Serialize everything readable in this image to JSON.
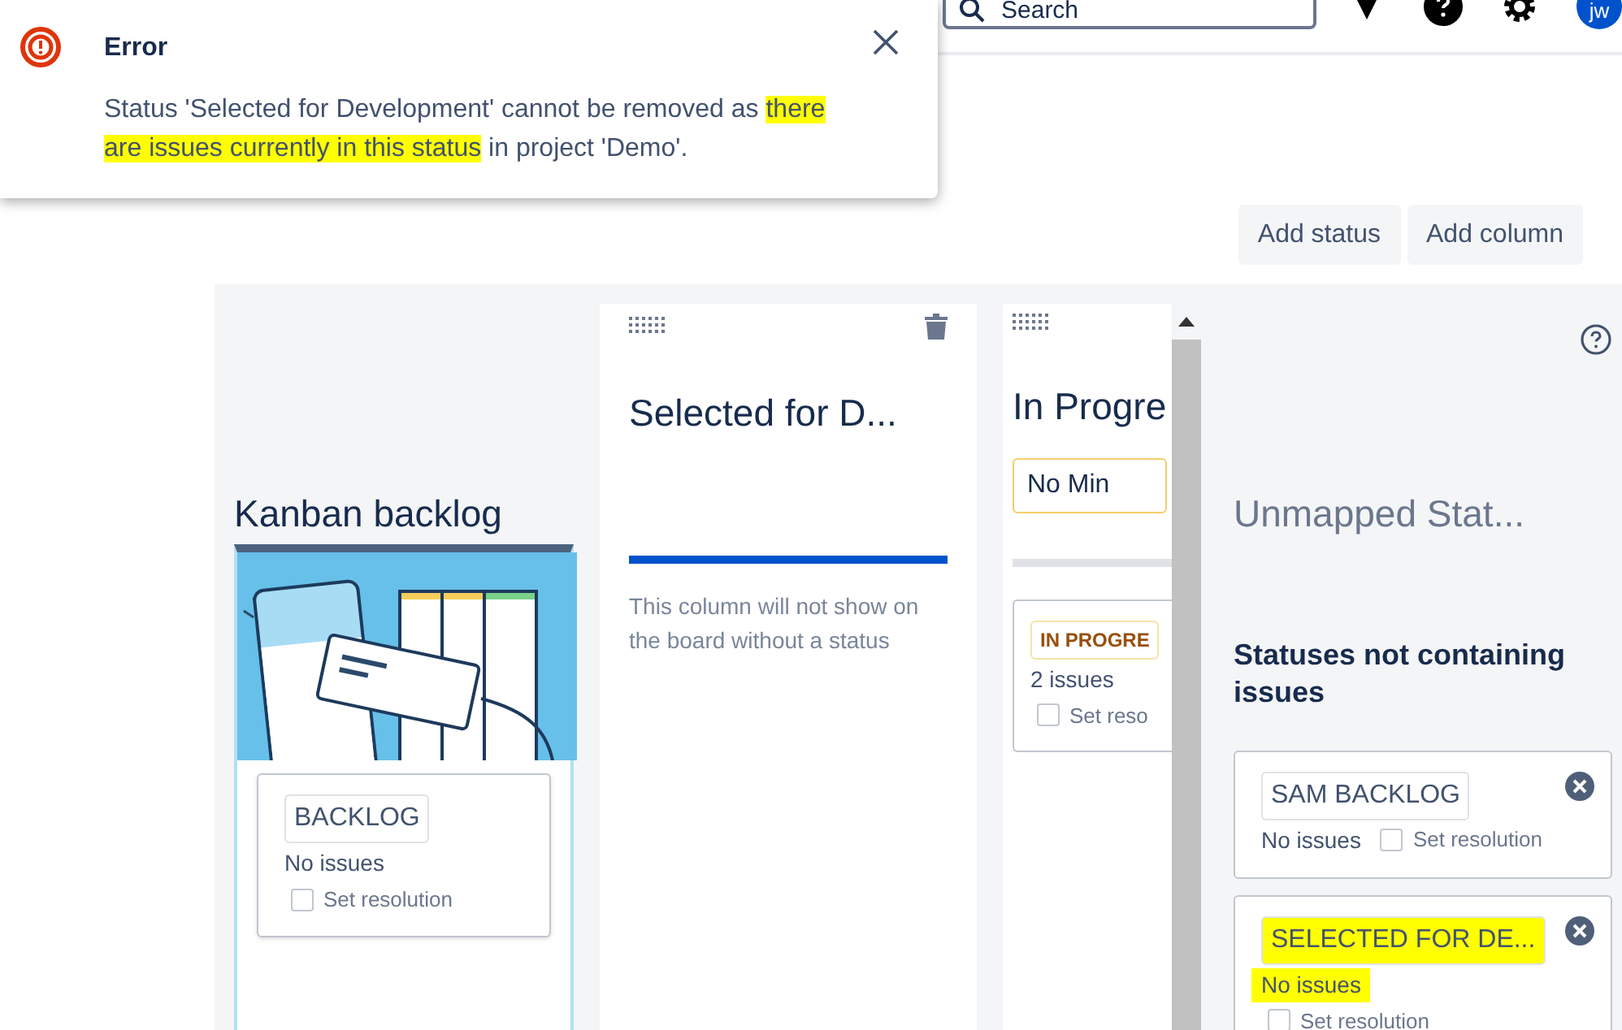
{
  "header": {
    "search": {
      "placeholder": "Search"
    },
    "avatar": "jw"
  },
  "error_popup": {
    "title": "Error",
    "message": [
      {
        "text": "Status 'Selected for Development' cannot be removed as ",
        "highlighted": false
      },
      {
        "text": "there are issues currently in this status",
        "highlighted": true
      },
      {
        "text": " in project 'Demo'.",
        "highlighted": false
      }
    ]
  },
  "buttons": [
    "Add status",
    "Add column"
  ],
  "columns": [
    {
      "kind": "backlog",
      "title": "Kanban backlog",
      "statuses": [
        {
          "label": "BACKLOG",
          "count": "No issues",
          "resolution": "Set resolution",
          "checked": false
        }
      ]
    },
    {
      "kind": "empty",
      "title": "Selected for D...",
      "note": "This column will not show on the board without a status"
    },
    {
      "kind": "limited",
      "title": "In Progre",
      "min": "No Min",
      "statuses": [
        {
          "label": "IN PROGRE",
          "count": "2 issues",
          "resolution": "Set reso",
          "checked": false
        }
      ]
    }
  ],
  "unmapped": {
    "title": "Unmapped Stat...",
    "subtitle": "Statuses not containing issues",
    "statuses": [
      {
        "label": "SAM BACKLOG",
        "count": "No issues",
        "resolution": "Set resolution",
        "checked": false,
        "highlighted": false
      },
      {
        "label": "SELECTED FOR DE...",
        "count": "No issues",
        "resolution": "Set resolution",
        "checked": false,
        "highlighted": true
      }
    ]
  }
}
